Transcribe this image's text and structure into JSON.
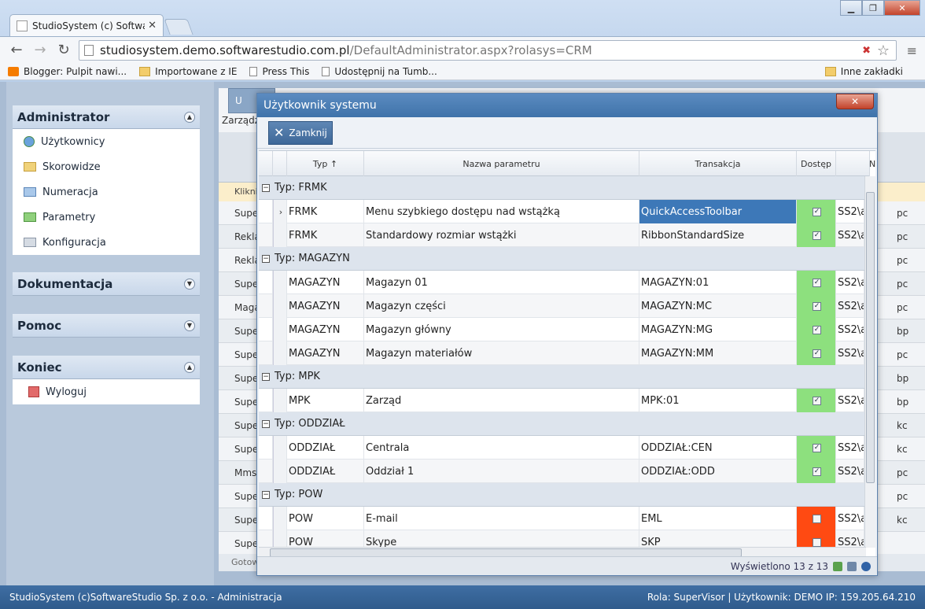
{
  "browser": {
    "tab_title": "StudioSystem (c) Software",
    "url_host": "studiosystem.demo.softwarestudio.com.pl",
    "url_path": "/DefaultAdministrator.aspx?rolasys=CRM",
    "bookmarks": [
      {
        "label": "Blogger: Pulpit nawi..."
      },
      {
        "label": "Importowane z IE"
      },
      {
        "label": "Press This"
      },
      {
        "label": "Udostępnij na Tumb..."
      }
    ],
    "other_bookmarks": "Inne zakładki"
  },
  "sidebar": {
    "administrator": {
      "title": "Administrator",
      "items": [
        {
          "label": "Użytkownicy"
        },
        {
          "label": "Skorowidze"
        },
        {
          "label": "Numeracja"
        },
        {
          "label": "Parametry"
        },
        {
          "label": "Konfiguracja"
        }
      ]
    },
    "dokumentacja": {
      "title": "Dokumentacja"
    },
    "pomoc": {
      "title": "Pomoc"
    },
    "koniec": {
      "title": "Koniec",
      "items": [
        {
          "label": "Wyloguj"
        }
      ]
    }
  },
  "background_grid": {
    "toolbar_label": "U",
    "crumb": "Zarządz",
    "filter_hint": "Klikni",
    "status": "Gotow",
    "rows": [
      "Supe",
      "Rekla",
      "Rekla",
      "Supe",
      "Maga",
      "Supe",
      "Supe",
      "Supe",
      "Supe",
      "Supe",
      "Supe",
      "Mms",
      "Supe",
      "Supe",
      "Supe"
    ],
    "right_col": [
      "pc",
      "pc",
      "pc",
      "pc",
      "pc",
      "bp",
      "pc",
      "bp",
      "bp",
      "kc",
      "kc",
      "pc",
      "pc",
      "kc"
    ]
  },
  "modal": {
    "title": "Użytkownik systemu",
    "close_label": "Zamknij",
    "columns": {
      "typ": "Typ ↑",
      "nazwa": "Nazwa parametru",
      "transakcja": "Transakcja",
      "dostep": "Dostęp",
      "n": "N"
    },
    "groups": [
      {
        "label": "Typ: FRMK",
        "rows": [
          {
            "typ": "FRMK",
            "nazwa": "Menu szybkiego dostępu nad wstążką",
            "transakcja": "QuickAccessToolbar",
            "dostep": true,
            "n": "SS2\\a",
            "selected": true
          },
          {
            "typ": "FRMK",
            "nazwa": "Standardowy rozmiar wstążki",
            "transakcja": "RibbonStandardSize",
            "dostep": true,
            "n": "SS2\\a"
          }
        ]
      },
      {
        "label": "Typ: MAGAZYN",
        "rows": [
          {
            "typ": "MAGAZYN",
            "nazwa": "Magazyn 01",
            "transakcja": "MAGAZYN:01",
            "dostep": true,
            "n": "SS2\\a"
          },
          {
            "typ": "MAGAZYN",
            "nazwa": "Magazyn części",
            "transakcja": "MAGAZYN:MC",
            "dostep": true,
            "n": "SS2\\a"
          },
          {
            "typ": "MAGAZYN",
            "nazwa": "Magazyn główny",
            "transakcja": "MAGAZYN:MG",
            "dostep": true,
            "n": "SS2\\a"
          },
          {
            "typ": "MAGAZYN",
            "nazwa": "Magazyn materiałów",
            "transakcja": "MAGAZYN:MM",
            "dostep": true,
            "n": "SS2\\a"
          }
        ]
      },
      {
        "label": "Typ: MPK",
        "rows": [
          {
            "typ": "MPK",
            "nazwa": "Zarząd",
            "transakcja": "MPK:01",
            "dostep": true,
            "n": "SS2\\a"
          }
        ]
      },
      {
        "label": "Typ: ODDZIAŁ",
        "rows": [
          {
            "typ": "ODDZIAŁ",
            "nazwa": "Centrala",
            "transakcja": "ODDZIAŁ:CEN",
            "dostep": true,
            "n": "SS2\\a"
          },
          {
            "typ": "ODDZIAŁ",
            "nazwa": "Oddział 1",
            "transakcja": "ODDZIAŁ:ODD",
            "dostep": true,
            "n": "SS2\\a"
          }
        ]
      },
      {
        "label": "Typ: POW",
        "rows": [
          {
            "typ": "POW",
            "nazwa": "E-mail",
            "transakcja": "EML",
            "dostep": false,
            "n": "SS2\\a"
          },
          {
            "typ": "POW",
            "nazwa": "Skype",
            "transakcja": "SKP",
            "dostep": false,
            "n": "SS2\\a"
          }
        ]
      }
    ],
    "footer_text": "Wyświetlono 13 z 13"
  },
  "statusbar": {
    "left": "StudioSystem (c)SoftwareStudio Sp. z o.o. - Administracja",
    "right": "Rola: SuperVisor | Użytkownik: DEMO IP: 159.205.64.210"
  },
  "colors": {
    "granted": "#8de07e",
    "denied": "#ff4a12",
    "selected": "#3d78b8"
  }
}
